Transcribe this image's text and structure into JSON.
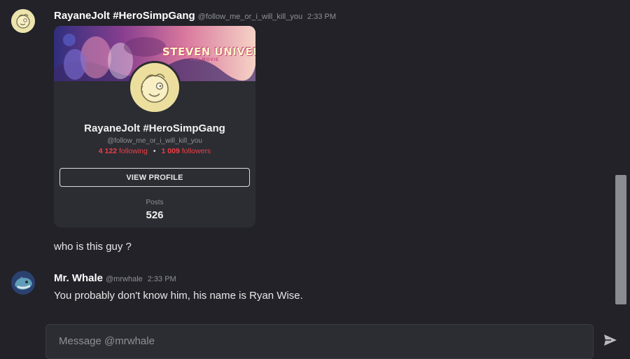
{
  "messages": [
    {
      "username": "RayaneJolt #HeroSimpGang",
      "handle": "@follow_me_or_i_will_kill_you",
      "time": "2:33 PM",
      "avatar_icon": "yellow-cartoon-face-avatar",
      "profile_card": {
        "banner_title": "STEVEN UNIVERSE",
        "banner_subtitle": "THE MOVIE",
        "name": "RayaneJolt #HeroSimpGang",
        "handle": "@follow_me_or_i_will_kill_you",
        "following_count": "4 122",
        "following_label": "following",
        "followers_count": "1 009",
        "followers_label": "followers",
        "separator": "•",
        "view_profile_label": "VIEW PROFILE",
        "posts_label": "Posts",
        "posts_value": "526"
      },
      "text": "who is this guy ?"
    },
    {
      "username": "Mr. Whale",
      "handle": "@mrwhale",
      "time": "2:33 PM",
      "avatar_icon": "blue-whale-avatar",
      "text": "You probably don't know him, his name is Ryan Wise."
    }
  ],
  "composer": {
    "placeholder": "Message @mrwhale",
    "send_icon": "send-arrow-icon"
  },
  "colors": {
    "background": "#222228",
    "card": "#2c2c33",
    "accent_red": "#f23f43",
    "scrollbar": "#8b8b92"
  }
}
